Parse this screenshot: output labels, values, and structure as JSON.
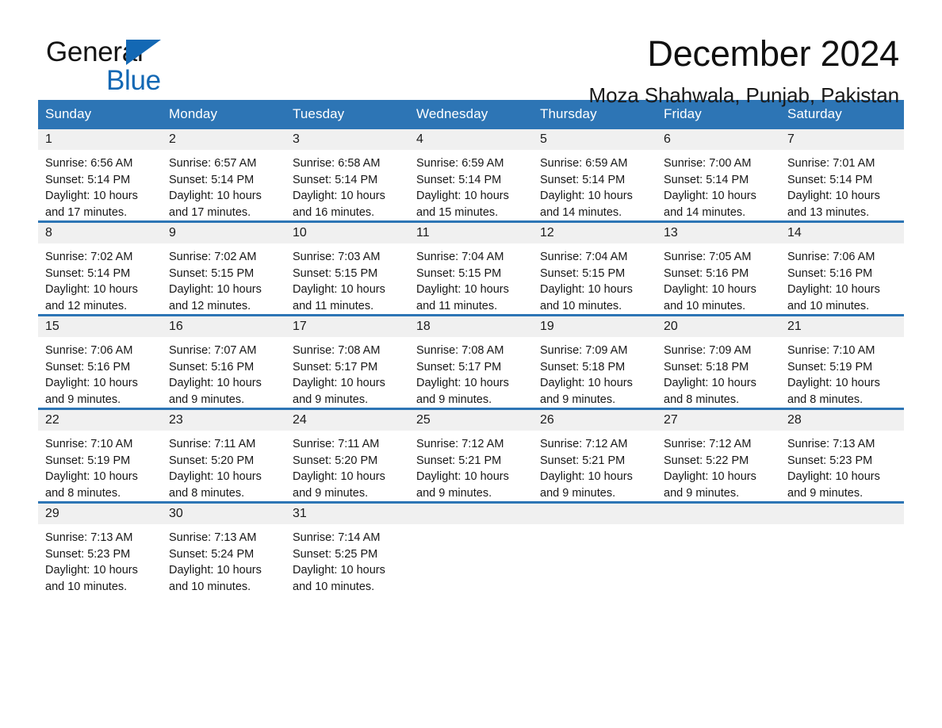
{
  "brand": {
    "line1": "General",
    "line2": "Blue",
    "triangle_color": "#1368b4"
  },
  "header": {
    "title": "December 2024",
    "subtitle": "Moza Shahwala, Punjab, Pakistan"
  },
  "theme": {
    "accent": "#2d75b5",
    "daynum_band": "#f0f0f0",
    "text": "#171717"
  },
  "calendar": {
    "day_headers": [
      "Sunday",
      "Monday",
      "Tuesday",
      "Wednesday",
      "Thursday",
      "Friday",
      "Saturday"
    ],
    "weeks": [
      [
        {
          "day": "1",
          "sunrise": "Sunrise: 6:56 AM",
          "sunset": "Sunset: 5:14 PM",
          "daylight_1": "Daylight: 10 hours",
          "daylight_2": "and 17 minutes."
        },
        {
          "day": "2",
          "sunrise": "Sunrise: 6:57 AM",
          "sunset": "Sunset: 5:14 PM",
          "daylight_1": "Daylight: 10 hours",
          "daylight_2": "and 17 minutes."
        },
        {
          "day": "3",
          "sunrise": "Sunrise: 6:58 AM",
          "sunset": "Sunset: 5:14 PM",
          "daylight_1": "Daylight: 10 hours",
          "daylight_2": "and 16 minutes."
        },
        {
          "day": "4",
          "sunrise": "Sunrise: 6:59 AM",
          "sunset": "Sunset: 5:14 PM",
          "daylight_1": "Daylight: 10 hours",
          "daylight_2": "and 15 minutes."
        },
        {
          "day": "5",
          "sunrise": "Sunrise: 6:59 AM",
          "sunset": "Sunset: 5:14 PM",
          "daylight_1": "Daylight: 10 hours",
          "daylight_2": "and 14 minutes."
        },
        {
          "day": "6",
          "sunrise": "Sunrise: 7:00 AM",
          "sunset": "Sunset: 5:14 PM",
          "daylight_1": "Daylight: 10 hours",
          "daylight_2": "and 14 minutes."
        },
        {
          "day": "7",
          "sunrise": "Sunrise: 7:01 AM",
          "sunset": "Sunset: 5:14 PM",
          "daylight_1": "Daylight: 10 hours",
          "daylight_2": "and 13 minutes."
        }
      ],
      [
        {
          "day": "8",
          "sunrise": "Sunrise: 7:02 AM",
          "sunset": "Sunset: 5:14 PM",
          "daylight_1": "Daylight: 10 hours",
          "daylight_2": "and 12 minutes."
        },
        {
          "day": "9",
          "sunrise": "Sunrise: 7:02 AM",
          "sunset": "Sunset: 5:15 PM",
          "daylight_1": "Daylight: 10 hours",
          "daylight_2": "and 12 minutes."
        },
        {
          "day": "10",
          "sunrise": "Sunrise: 7:03 AM",
          "sunset": "Sunset: 5:15 PM",
          "daylight_1": "Daylight: 10 hours",
          "daylight_2": "and 11 minutes."
        },
        {
          "day": "11",
          "sunrise": "Sunrise: 7:04 AM",
          "sunset": "Sunset: 5:15 PM",
          "daylight_1": "Daylight: 10 hours",
          "daylight_2": "and 11 minutes."
        },
        {
          "day": "12",
          "sunrise": "Sunrise: 7:04 AM",
          "sunset": "Sunset: 5:15 PM",
          "daylight_1": "Daylight: 10 hours",
          "daylight_2": "and 10 minutes."
        },
        {
          "day": "13",
          "sunrise": "Sunrise: 7:05 AM",
          "sunset": "Sunset: 5:16 PM",
          "daylight_1": "Daylight: 10 hours",
          "daylight_2": "and 10 minutes."
        },
        {
          "day": "14",
          "sunrise": "Sunrise: 7:06 AM",
          "sunset": "Sunset: 5:16 PM",
          "daylight_1": "Daylight: 10 hours",
          "daylight_2": "and 10 minutes."
        }
      ],
      [
        {
          "day": "15",
          "sunrise": "Sunrise: 7:06 AM",
          "sunset": "Sunset: 5:16 PM",
          "daylight_1": "Daylight: 10 hours",
          "daylight_2": "and 9 minutes."
        },
        {
          "day": "16",
          "sunrise": "Sunrise: 7:07 AM",
          "sunset": "Sunset: 5:16 PM",
          "daylight_1": "Daylight: 10 hours",
          "daylight_2": "and 9 minutes."
        },
        {
          "day": "17",
          "sunrise": "Sunrise: 7:08 AM",
          "sunset": "Sunset: 5:17 PM",
          "daylight_1": "Daylight: 10 hours",
          "daylight_2": "and 9 minutes."
        },
        {
          "day": "18",
          "sunrise": "Sunrise: 7:08 AM",
          "sunset": "Sunset: 5:17 PM",
          "daylight_1": "Daylight: 10 hours",
          "daylight_2": "and 9 minutes."
        },
        {
          "day": "19",
          "sunrise": "Sunrise: 7:09 AM",
          "sunset": "Sunset: 5:18 PM",
          "daylight_1": "Daylight: 10 hours",
          "daylight_2": "and 9 minutes."
        },
        {
          "day": "20",
          "sunrise": "Sunrise: 7:09 AM",
          "sunset": "Sunset: 5:18 PM",
          "daylight_1": "Daylight: 10 hours",
          "daylight_2": "and 8 minutes."
        },
        {
          "day": "21",
          "sunrise": "Sunrise: 7:10 AM",
          "sunset": "Sunset: 5:19 PM",
          "daylight_1": "Daylight: 10 hours",
          "daylight_2": "and 8 minutes."
        }
      ],
      [
        {
          "day": "22",
          "sunrise": "Sunrise: 7:10 AM",
          "sunset": "Sunset: 5:19 PM",
          "daylight_1": "Daylight: 10 hours",
          "daylight_2": "and 8 minutes."
        },
        {
          "day": "23",
          "sunrise": "Sunrise: 7:11 AM",
          "sunset": "Sunset: 5:20 PM",
          "daylight_1": "Daylight: 10 hours",
          "daylight_2": "and 8 minutes."
        },
        {
          "day": "24",
          "sunrise": "Sunrise: 7:11 AM",
          "sunset": "Sunset: 5:20 PM",
          "daylight_1": "Daylight: 10 hours",
          "daylight_2": "and 9 minutes."
        },
        {
          "day": "25",
          "sunrise": "Sunrise: 7:12 AM",
          "sunset": "Sunset: 5:21 PM",
          "daylight_1": "Daylight: 10 hours",
          "daylight_2": "and 9 minutes."
        },
        {
          "day": "26",
          "sunrise": "Sunrise: 7:12 AM",
          "sunset": "Sunset: 5:21 PM",
          "daylight_1": "Daylight: 10 hours",
          "daylight_2": "and 9 minutes."
        },
        {
          "day": "27",
          "sunrise": "Sunrise: 7:12 AM",
          "sunset": "Sunset: 5:22 PM",
          "daylight_1": "Daylight: 10 hours",
          "daylight_2": "and 9 minutes."
        },
        {
          "day": "28",
          "sunrise": "Sunrise: 7:13 AM",
          "sunset": "Sunset: 5:23 PM",
          "daylight_1": "Daylight: 10 hours",
          "daylight_2": "and 9 minutes."
        }
      ],
      [
        {
          "day": "29",
          "sunrise": "Sunrise: 7:13 AM",
          "sunset": "Sunset: 5:23 PM",
          "daylight_1": "Daylight: 10 hours",
          "daylight_2": "and 10 minutes."
        },
        {
          "day": "30",
          "sunrise": "Sunrise: 7:13 AM",
          "sunset": "Sunset: 5:24 PM",
          "daylight_1": "Daylight: 10 hours",
          "daylight_2": "and 10 minutes."
        },
        {
          "day": "31",
          "sunrise": "Sunrise: 7:14 AM",
          "sunset": "Sunset: 5:25 PM",
          "daylight_1": "Daylight: 10 hours",
          "daylight_2": "and 10 minutes."
        },
        {
          "day": "",
          "sunrise": "",
          "sunset": "",
          "daylight_1": "",
          "daylight_2": ""
        },
        {
          "day": "",
          "sunrise": "",
          "sunset": "",
          "daylight_1": "",
          "daylight_2": ""
        },
        {
          "day": "",
          "sunrise": "",
          "sunset": "",
          "daylight_1": "",
          "daylight_2": ""
        },
        {
          "day": "",
          "sunrise": "",
          "sunset": "",
          "daylight_1": "",
          "daylight_2": ""
        }
      ]
    ]
  }
}
